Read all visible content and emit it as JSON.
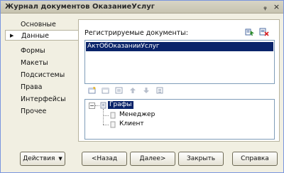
{
  "window": {
    "title": "Журнал документов ОказаниеУслуг",
    "pin_glyph": "ᵩ",
    "close_glyph": "×"
  },
  "nav": {
    "items": [
      {
        "label": "Основные"
      },
      {
        "label": "Данные",
        "active": true
      },
      {
        "label": "Формы"
      },
      {
        "label": "Макеты"
      },
      {
        "label": "Подсистемы"
      },
      {
        "label": "Права"
      },
      {
        "label": "Интерфейсы"
      },
      {
        "label": "Прочее"
      }
    ],
    "active_marker": "▶"
  },
  "registered": {
    "label": "Регистрируемые документы:",
    "items": [
      "АктОбОказанииУслуг"
    ]
  },
  "tree": {
    "root": "Графы",
    "children": [
      "Менеджер",
      "Клиент"
    ],
    "expand_glyph": "−"
  },
  "buttons": {
    "actions": "Действия",
    "actions_arrow": "▼",
    "back": "<Назад",
    "next": "Далее>",
    "close": "Закрыть",
    "help": "Справка"
  },
  "colors": {
    "selection": "#0a246a",
    "window_bg": "#f1efe2"
  }
}
